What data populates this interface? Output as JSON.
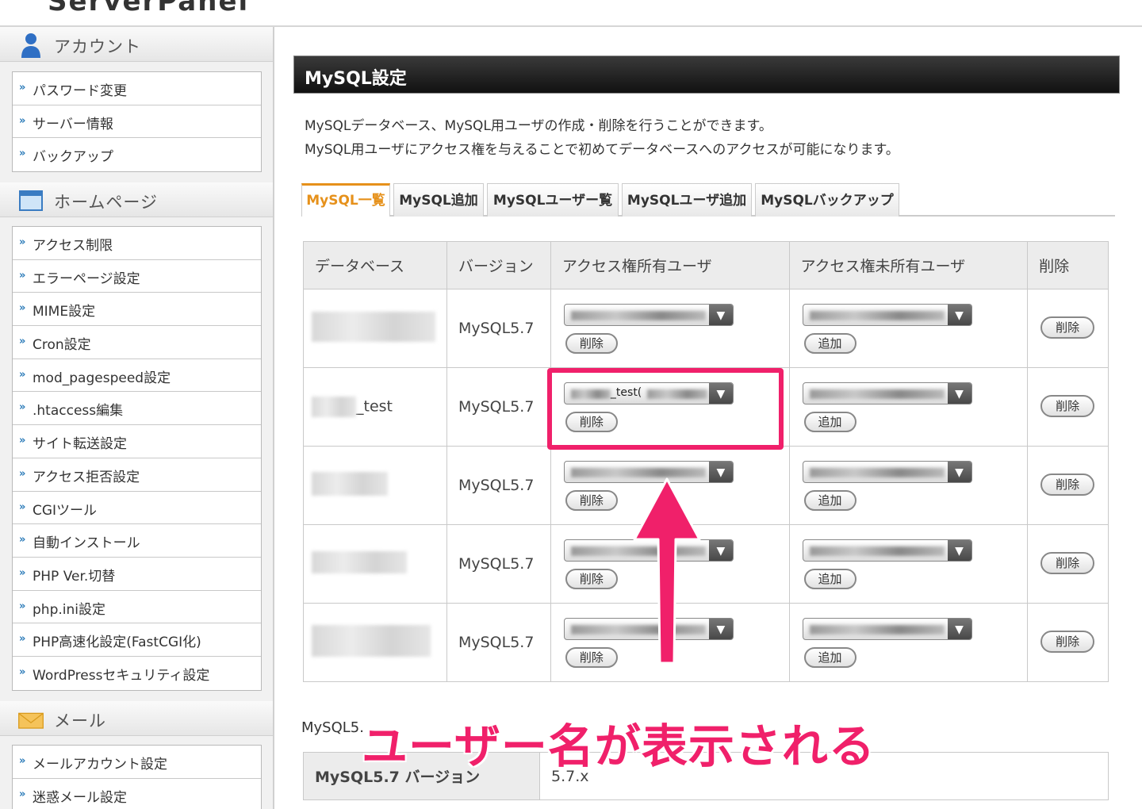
{
  "header": {
    "logo_text": "ServerPanel"
  },
  "sidebar": {
    "sections": [
      {
        "title": "アカウント",
        "icon": "user-icon",
        "items": [
          "パスワード変更",
          "サーバー情報",
          "バックアップ"
        ]
      },
      {
        "title": "ホームページ",
        "icon": "homepage-icon",
        "items": [
          "アクセス制限",
          "エラーページ設定",
          "MIME設定",
          "Cron設定",
          "mod_pagespeed設定",
          ".htaccess編集",
          "サイト転送設定",
          "アクセス拒否設定",
          "CGIツール",
          "自動インストール",
          "PHP Ver.切替",
          "php.ini設定",
          "PHP高速化設定(FastCGI化)",
          "WordPressセキュリティ設定"
        ]
      },
      {
        "title": "メール",
        "icon": "mail-icon",
        "items": [
          "メールアカウント設定",
          "迷惑メール設定"
        ]
      }
    ]
  },
  "main": {
    "title": "MySQL設定",
    "description": [
      "MySQLデータベース、MySQL用ユーザの作成・削除を行うことができます。",
      "MySQL用ユーザにアクセス権を与えることで初めてデータベースへのアクセスが可能になります。"
    ],
    "tabs": [
      "MySQL一覧",
      "MySQL追加",
      "MySQLユーザー覧",
      "MySQLユーザ追加",
      "MySQLバックアップ"
    ],
    "active_tab": "MySQL一覧",
    "table": {
      "headers": [
        "データベース",
        "バージョン",
        "アクセス権所有ユーザ",
        "アクセス権未所有ユーザ",
        "削除"
      ],
      "rows": [
        {
          "db_suffix": "",
          "version": "MySQL5.7",
          "owner_user_visible": "",
          "remove_label": "削除",
          "add_label": "追加",
          "delete_label": "削除"
        },
        {
          "db_suffix": "_test",
          "version": "MySQL5.7",
          "owner_user_visible": "_test(",
          "remove_label": "削除",
          "add_label": "追加",
          "delete_label": "削除"
        },
        {
          "db_suffix": "",
          "version": "MySQL5.7",
          "owner_user_visible": "",
          "remove_label": "削除",
          "add_label": "追加",
          "delete_label": "削除"
        },
        {
          "db_suffix": "",
          "version": "MySQL5.7",
          "owner_user_visible": "",
          "remove_label": "削除",
          "add_label": "追加",
          "delete_label": "削除"
        },
        {
          "db_suffix": "",
          "version": "MySQL5.7",
          "owner_user_visible": "",
          "remove_label": "削除",
          "add_label": "追加",
          "delete_label": "削除"
        }
      ]
    },
    "info_label": "MySQL5.",
    "info_table": {
      "key": "MySQL5.7 バージョン",
      "value": "5.7.x"
    }
  },
  "annotation": {
    "text": "ユーザー名が表示される",
    "color": "#f0206a"
  },
  "colors": {
    "accent_tab": "#e6911b",
    "title_bar": "#1a1a1a",
    "annotation": "#f0206a"
  }
}
